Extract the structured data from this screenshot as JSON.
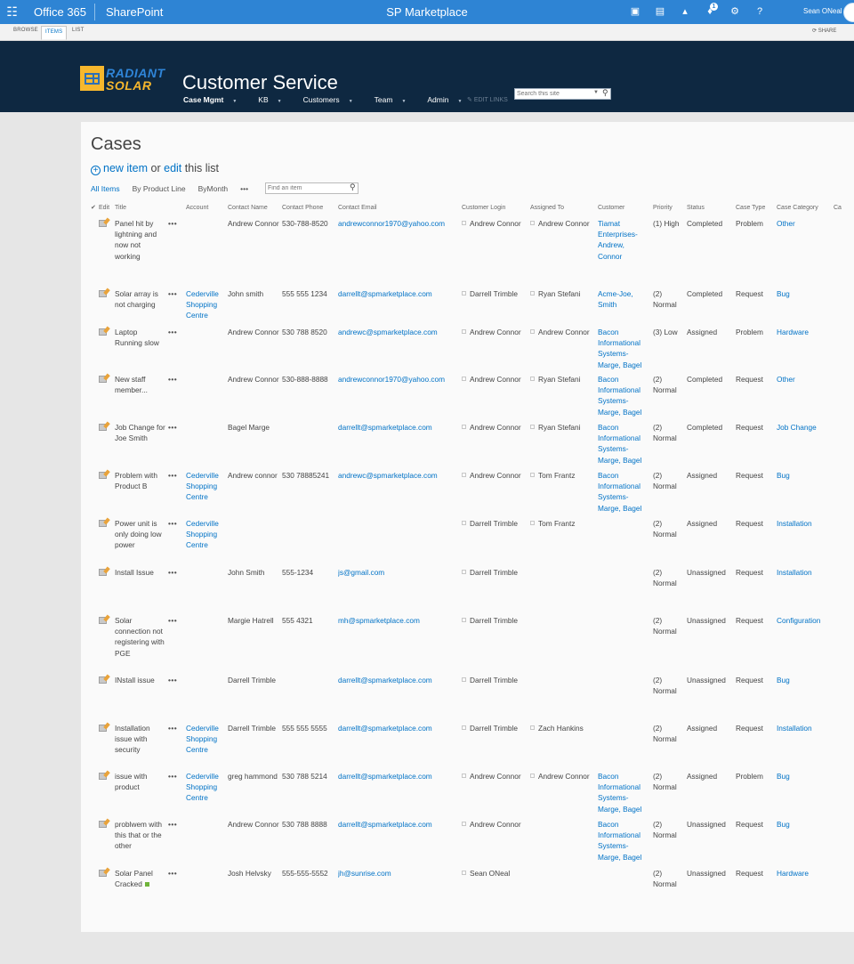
{
  "suite_bar": {
    "waffle": "☷",
    "brand": "Office 365",
    "app": "SharePoint",
    "site_name": "SP Marketplace",
    "notification_count": "1",
    "user_name": "Sean ONeal",
    "icons": [
      "newsfeed-icon",
      "onedrive-icon",
      "sites-icon",
      "notifications-icon",
      "settings-icon",
      "help-icon"
    ]
  },
  "ribbon": {
    "tabs": [
      "BROWSE",
      "ITEMS",
      "LIST"
    ],
    "active_tab": "ITEMS",
    "share": "SHARE"
  },
  "header": {
    "logo_line1": "RADIANT",
    "logo_line2": "SOLAR",
    "site_title": "Customer Service",
    "nav": [
      "Case Mgmt",
      "KB",
      "Customers",
      "Team",
      "Admin"
    ],
    "edit_links": "EDIT LINKS",
    "search_placeholder": "Search this site"
  },
  "content": {
    "title": "Cases",
    "new_item": "new item",
    "or": "or",
    "edit": "edit",
    "this_list": "this list",
    "views": [
      "All Items",
      "By Product Line",
      "ByMonth",
      "•••"
    ],
    "active_view": "All Items",
    "find_placeholder": "Find an item"
  },
  "table": {
    "columns": [
      "✔",
      "Edit",
      "Title",
      "",
      "Account",
      "Contact Name",
      "Contact Phone",
      "Contact Email",
      "Customer Login",
      "Assigned To",
      "Customer",
      "Priority",
      "Status",
      "Case Type",
      "Case Category",
      "Ca"
    ],
    "rows": [
      {
        "title": "Panel hit by lightning and now not working",
        "account": "",
        "contact": "Andrew Connor",
        "phone": "530-788-8520",
        "email": "andrewconnor1970@yahoo.com",
        "login": "Andrew Connor",
        "assigned": "Andrew Connor",
        "customer": "Tiamat Enterprises-Andrew, Connor",
        "priority": "(1) High",
        "status": "Completed",
        "type": "Problem",
        "category": "Other"
      },
      {
        "title": "Solar array is not charging",
        "account": "Cederville Shopping Centre",
        "contact": "John smith",
        "phone": "555 555 1234",
        "email": "darrellt@spmarketplace.com",
        "login": "Darrell Trimble",
        "assigned": "Ryan Stefani",
        "customer": "Acme-Joe, Smith",
        "priority": "(2) Normal",
        "status": "Completed",
        "type": "Request",
        "category": "Bug"
      },
      {
        "title": "Laptop Running slow",
        "account": "",
        "contact": "Andrew Connor",
        "phone": "530 788 8520",
        "email": "andrewc@spmarketplace.com",
        "login": "Andrew Connor",
        "assigned": "Andrew Connor",
        "customer": "Bacon Informational Systems-Marge, Bagel",
        "priority": "(3) Low",
        "status": "Assigned",
        "type": "Problem",
        "category": "Hardware"
      },
      {
        "title": "New staff member...",
        "account": "",
        "contact": "Andrew Connor",
        "phone": "530-888-8888",
        "email": "andrewconnor1970@yahoo.com",
        "login": "Andrew Connor",
        "assigned": "Ryan Stefani",
        "customer": "Bacon Informational Systems-Marge, Bagel",
        "priority": "(2) Normal",
        "status": "Completed",
        "type": "Request",
        "category": "Other"
      },
      {
        "title": "Job Change for Joe Smith",
        "account": "",
        "contact": "Bagel Marge",
        "phone": "",
        "email": "darrellt@spmarketplace.com",
        "login": "Andrew Connor",
        "assigned": "Ryan Stefani",
        "customer": "Bacon Informational Systems-Marge, Bagel",
        "priority": "(2) Normal",
        "status": "Completed",
        "type": "Request",
        "category": "Job Change"
      },
      {
        "title": "Problem with Product B",
        "account": "Cederville Shopping Centre",
        "contact": "Andrew connor",
        "phone": "530 78885241",
        "email": "andrewc@spmarketplace.com",
        "login": "Andrew Connor",
        "assigned": "Tom Frantz",
        "customer": "Bacon Informational Systems-Marge, Bagel",
        "priority": "(2) Normal",
        "status": "Assigned",
        "type": "Request",
        "category": "Bug"
      },
      {
        "title": "Power unit is only doing low power",
        "account": "Cederville Shopping Centre",
        "contact": "",
        "phone": "",
        "email": "",
        "login": "Darrell Trimble",
        "assigned": "Tom Frantz",
        "customer": "",
        "priority": "(2) Normal",
        "status": "Assigned",
        "type": "Request",
        "category": "Installation"
      },
      {
        "title": "Install Issue",
        "account": "",
        "contact": "John Smith",
        "phone": "555-1234",
        "email": "js@gmail.com",
        "login": "Darrell Trimble",
        "assigned": "",
        "customer": "",
        "priority": "(2) Normal",
        "status": "Unassigned",
        "type": "Request",
        "category": "Installation"
      },
      {
        "title": "Solar connection not registering with PGE",
        "account": "",
        "contact": "Margie Hatrell",
        "phone": "555 4321",
        "email": "mh@spmarketplace.com",
        "login": "Darrell Trimble",
        "assigned": "",
        "customer": "",
        "priority": "(2) Normal",
        "status": "Unassigned",
        "type": "Request",
        "category": "Configuration"
      },
      {
        "title": "INstall issue",
        "account": "",
        "contact": "Darrell Trimble",
        "phone": "",
        "email": "darrellt@spmarketplace.com",
        "login": "Darrell Trimble",
        "assigned": "",
        "customer": "",
        "priority": "(2) Normal",
        "status": "Unassigned",
        "type": "Request",
        "category": "Bug"
      },
      {
        "title": "Installation issue with security",
        "account": "Cederville Shopping Centre",
        "contact": "Darrell Trimble",
        "phone": "555 555 5555",
        "email": "darrellt@spmarketplace.com",
        "login": "Darrell Trimble",
        "assigned": "Zach Hankins",
        "customer": "",
        "priority": "(2) Normal",
        "status": "Assigned",
        "type": "Request",
        "category": "Installation"
      },
      {
        "title": "issue with product",
        "account": "Cederville Shopping Centre",
        "contact": "greg hammond",
        "phone": "530 788 5214",
        "email": "darrellt@spmarketplace.com",
        "login": "Andrew Connor",
        "assigned": "Andrew Connor",
        "customer": "Bacon Informational Systems-Marge, Bagel",
        "priority": "(2) Normal",
        "status": "Assigned",
        "type": "Problem",
        "category": "Bug"
      },
      {
        "title": "problwem with this that or the other",
        "account": "",
        "contact": "Andrew Connor",
        "phone": "530 788 8888",
        "email": "darrellt@spmarketplace.com",
        "login": "Andrew Connor",
        "assigned": "",
        "customer": "Bacon Informational Systems-Marge, Bagel",
        "priority": "(2) Normal",
        "status": "Unassigned",
        "type": "Request",
        "category": "Bug"
      },
      {
        "title": "Solar Panel Cracked",
        "account": "",
        "contact": "Josh Helvsky",
        "phone": "555-555-5552",
        "email": "jh@sunrise.com",
        "login": "Sean ONeal",
        "assigned": "",
        "customer": "",
        "priority": "(2) Normal",
        "status": "Unassigned",
        "type": "Request",
        "category": "Hardware",
        "is_new": true
      }
    ]
  }
}
